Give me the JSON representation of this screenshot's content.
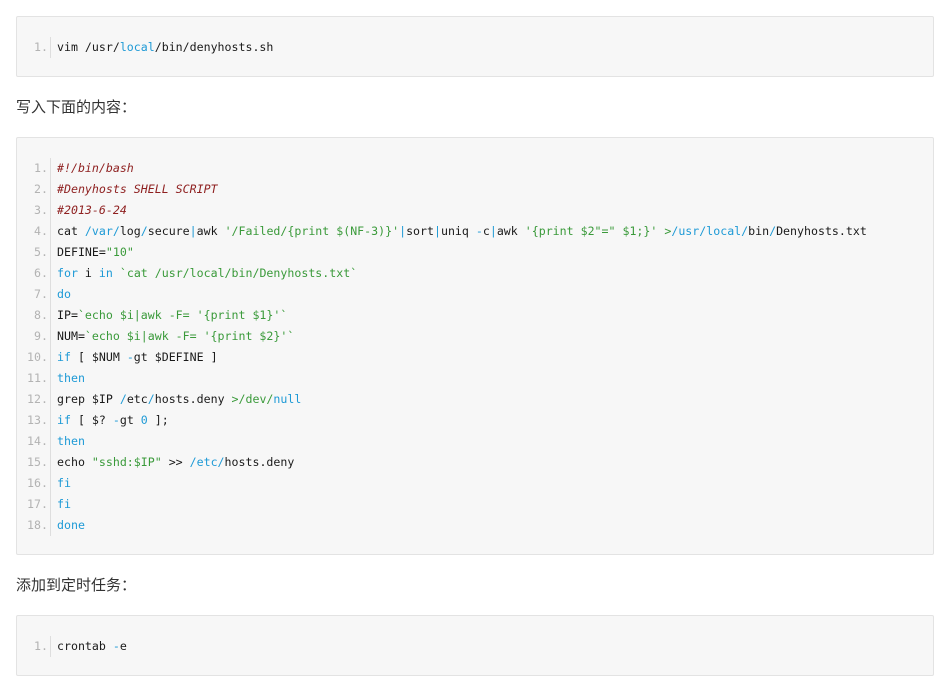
{
  "blocks": [
    {
      "lines": [
        {
          "n": "1.",
          "tokens": [
            [
              "p",
              "vim "
            ],
            [
              "p",
              "/usr/"
            ],
            [
              "k",
              "local"
            ],
            [
              "p",
              "/bin/denyhosts.sh"
            ]
          ]
        }
      ]
    },
    {
      "lines": [
        {
          "n": "1.",
          "tokens": [
            [
              "c",
              "#!/bin/bash"
            ]
          ]
        },
        {
          "n": "2.",
          "tokens": [
            [
              "c",
              "#Denyhosts SHELL SCRIPT"
            ]
          ]
        },
        {
          "n": "3.",
          "tokens": [
            [
              "c",
              "#2013-6-24"
            ]
          ]
        },
        {
          "n": "4.",
          "tokens": [
            [
              "p",
              "cat "
            ],
            [
              "k",
              "/var/"
            ],
            [
              "p",
              "log"
            ],
            [
              "k",
              "/"
            ],
            [
              "p",
              "secure"
            ],
            [
              "k",
              "|"
            ],
            [
              "p",
              "awk "
            ],
            [
              "s",
              "'/Failed/{print $(NF-3)}'"
            ],
            [
              "k",
              "|"
            ],
            [
              "p",
              "sort"
            ],
            [
              "k",
              "|"
            ],
            [
              "p",
              "uniq "
            ],
            [
              "k",
              "-"
            ],
            [
              "p",
              "c"
            ],
            [
              "k",
              "|"
            ],
            [
              "p",
              "awk "
            ],
            [
              "s",
              "'{print $2\"=\" $1;}'"
            ],
            [
              "s",
              " >"
            ],
            [
              "k",
              "/usr/"
            ],
            [
              "k",
              "local"
            ],
            [
              "k",
              "/"
            ],
            [
              "p",
              "bin"
            ],
            [
              "k",
              "/"
            ],
            [
              "p",
              "Denyhosts.txt"
            ]
          ]
        },
        {
          "n": "5.",
          "tokens": [
            [
              "p",
              "DEFINE="
            ],
            [
              "s",
              "\"10\""
            ]
          ]
        },
        {
          "n": "6.",
          "tokens": [
            [
              "k",
              "for"
            ],
            [
              "p",
              " i "
            ],
            [
              "k",
              "in"
            ],
            [
              "s",
              " `cat /usr/local/bin/Denyhosts.txt`"
            ]
          ]
        },
        {
          "n": "7.",
          "tokens": [
            [
              "k",
              "do"
            ]
          ]
        },
        {
          "n": "8.",
          "tokens": [
            [
              "p",
              "IP="
            ],
            [
              "s",
              "`echo $i|awk -F= '{print $1}'`"
            ]
          ]
        },
        {
          "n": "9.",
          "tokens": [
            [
              "p",
              "NUM="
            ],
            [
              "s",
              "`echo $i|awk -F= '{print $2}'`"
            ]
          ]
        },
        {
          "n": "10.",
          "tokens": [
            [
              "k",
              "if"
            ],
            [
              "p",
              " [ $NUM "
            ],
            [
              "k",
              "-"
            ],
            [
              "p",
              "gt $DEFINE ]"
            ]
          ]
        },
        {
          "n": "11.",
          "tokens": [
            [
              "k",
              "then"
            ]
          ]
        },
        {
          "n": "12.",
          "tokens": [
            [
              "p",
              "grep $IP "
            ],
            [
              "k",
              "/"
            ],
            [
              "p",
              "etc"
            ],
            [
              "k",
              "/"
            ],
            [
              "p",
              "hosts.deny "
            ],
            [
              "s",
              ">/dev/"
            ],
            [
              "k",
              "null"
            ]
          ]
        },
        {
          "n": "13.",
          "tokens": [
            [
              "k",
              "if"
            ],
            [
              "p",
              " [ $? "
            ],
            [
              "k",
              "-"
            ],
            [
              "p",
              "gt "
            ],
            [
              "k",
              "0"
            ],
            [
              "p",
              " ];"
            ]
          ]
        },
        {
          "n": "14.",
          "tokens": [
            [
              "k",
              "then"
            ]
          ]
        },
        {
          "n": "15.",
          "tokens": [
            [
              "p",
              "echo "
            ],
            [
              "s",
              "\"sshd:$IP\""
            ],
            [
              "p",
              " >> "
            ],
            [
              "k",
              "/etc/"
            ],
            [
              "p",
              "hosts.deny"
            ]
          ]
        },
        {
          "n": "16.",
          "tokens": [
            [
              "k",
              "fi"
            ]
          ]
        },
        {
          "n": "17.",
          "tokens": [
            [
              "k",
              "fi"
            ]
          ]
        },
        {
          "n": "18.",
          "tokens": [
            [
              "k",
              "done"
            ]
          ]
        }
      ]
    },
    {
      "lines": [
        {
          "n": "1.",
          "tokens": [
            [
              "p",
              "crontab "
            ],
            [
              "k",
              "-"
            ],
            [
              "p",
              "e"
            ]
          ]
        }
      ]
    }
  ],
  "paragraphs": {
    "p1": "写入下面的内容：",
    "p2": "添加到定时任务："
  }
}
